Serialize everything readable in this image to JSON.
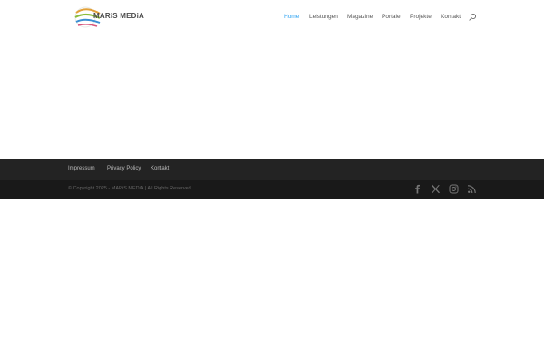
{
  "brand": {
    "name": "MARiS MEDiA"
  },
  "nav": {
    "items": [
      "Home",
      "Leistungen",
      "Magazine",
      "Portale",
      "Projekte",
      "Kontakt"
    ],
    "active": "Home"
  },
  "footer": {
    "links": [
      "Impressum",
      "Privacy Policy",
      "Kontakt"
    ],
    "copyright": "© Copyright 2025 - MARiS MEDiA | All Rights Reserved"
  },
  "social": [
    "facebook-icon",
    "x-icon",
    "instagram-icon",
    "rss-icon"
  ],
  "colors": {
    "accent": "#2ea3f2",
    "footer_top": "#232323",
    "footer_bottom": "#191919"
  }
}
